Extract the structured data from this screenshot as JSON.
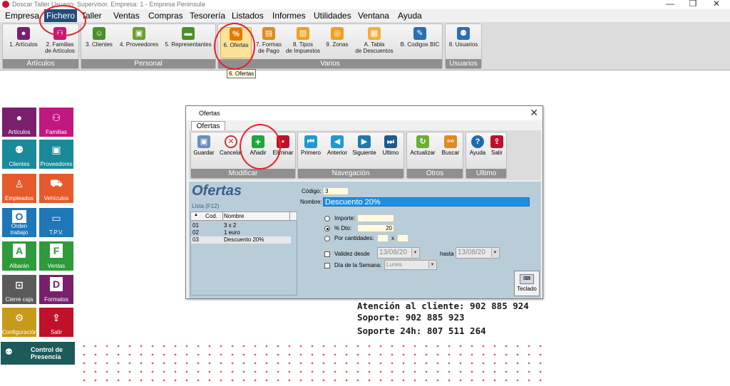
{
  "titlebar": {
    "text": "Doscar Taller Usuario: Supervisor. Empresa: 1 - Empresa Peninsula",
    "min": "—",
    "restore": "❐",
    "close": "✕"
  },
  "menu": [
    "Empresa",
    "Fichero",
    "Taller",
    "Ventas",
    "Compras",
    "Tesorería",
    "Listados",
    "Informes",
    "Utilidades",
    "Ventana",
    "Ayuda"
  ],
  "ribbon": {
    "groups": {
      "articulos": "Artículos",
      "personal": "Personal",
      "varios": "Varios",
      "usuarios": "Usuarios"
    },
    "buttons": {
      "articulos": "1. Artículos",
      "familias_l1": "2. Familias",
      "familias_l2": "de Artículos",
      "clientes": "3. Clientes",
      "proveedores": "4. Proveedores",
      "representantes": "5. Representantes",
      "ofertas": "6. Ofertas",
      "formas_l1": "7. Formas",
      "formas_l2": "de Pago",
      "tipos_l1": "8. Tipos",
      "tipos_l2": "de Impuestos",
      "zonas": "9. Zonas",
      "tabla_l1": "A. Tabla",
      "tabla_l2": "de Descuentos",
      "codigos": "B. Codigos BIC",
      "usuarios": "8. Usuarios"
    },
    "tooltip": "6. Ofertas"
  },
  "tiles": {
    "articulos": "Artículos",
    "familias": "Familias",
    "clientes": "Clientes",
    "proveedores": "Proveedores",
    "empleados": "Empleados",
    "vehiculos": "Vehículos",
    "orden": "Orden trabajo",
    "tpv": "T.P.V.",
    "albaran": "Albarán",
    "ventas": "Ventas",
    "cierre": "Cierre caja",
    "formatos": "Formatos",
    "configuracion": "Configuración",
    "salir": "Salir",
    "presencia_l1": "Control de",
    "presencia_l2": "Presencia"
  },
  "contact": {
    "line1": "Atención al cliente: 902 885 924",
    "line2": "Soporte: 902 885 923",
    "line3": "Soporte 24h: 807 511 264"
  },
  "dialog": {
    "title": "Ofertas",
    "tab": "Ofertas",
    "groups": {
      "modificar": "Modificar",
      "navegacion": "Navegación",
      "otros": "Otros",
      "ultimo": "Ultimo"
    },
    "buttons": {
      "guardar": "Guardar",
      "cancelar": "Cancelar",
      "anadir": "Añadir",
      "eliminar": "Eliminar",
      "primero": "Primero",
      "anterior": "Anterior",
      "siguiente": "Siguiente",
      "ultimo": "Ultimo",
      "actualizar": "Actualizar",
      "buscar": "Buscar",
      "ayuda": "Ayuda",
      "salir": "Salir"
    },
    "heading": "Ofertas",
    "lista_label": "Lista (F12)",
    "list_headers": {
      "sort": "▲",
      "cod": "Cod.",
      "nombre": "Nombre"
    },
    "list_rows": [
      {
        "cod": "01",
        "nombre": "3 x 2"
      },
      {
        "cod": "02",
        "nombre": "1 euro"
      },
      {
        "cod": "03",
        "nombre": "Descuento 20%"
      }
    ],
    "form": {
      "codigo_label": "Código:",
      "codigo_value": "3",
      "nombre_label": "Nombre:",
      "nombre_value": "Descuento 20%",
      "importe_label": "Importe:",
      "importe_value": "",
      "dto_label": "% Dto:",
      "dto_value": "20",
      "cantidades_label": "Por cantidades:",
      "cantidades_x": "x",
      "validez_label": "Validez desde",
      "validez_desde": "13/08/20",
      "hasta_label": "hasta",
      "validez_hasta": "13/08/20",
      "dia_label": "Día de la Semana:",
      "dia_value": "Lunes"
    },
    "teclado": "Teclado"
  }
}
